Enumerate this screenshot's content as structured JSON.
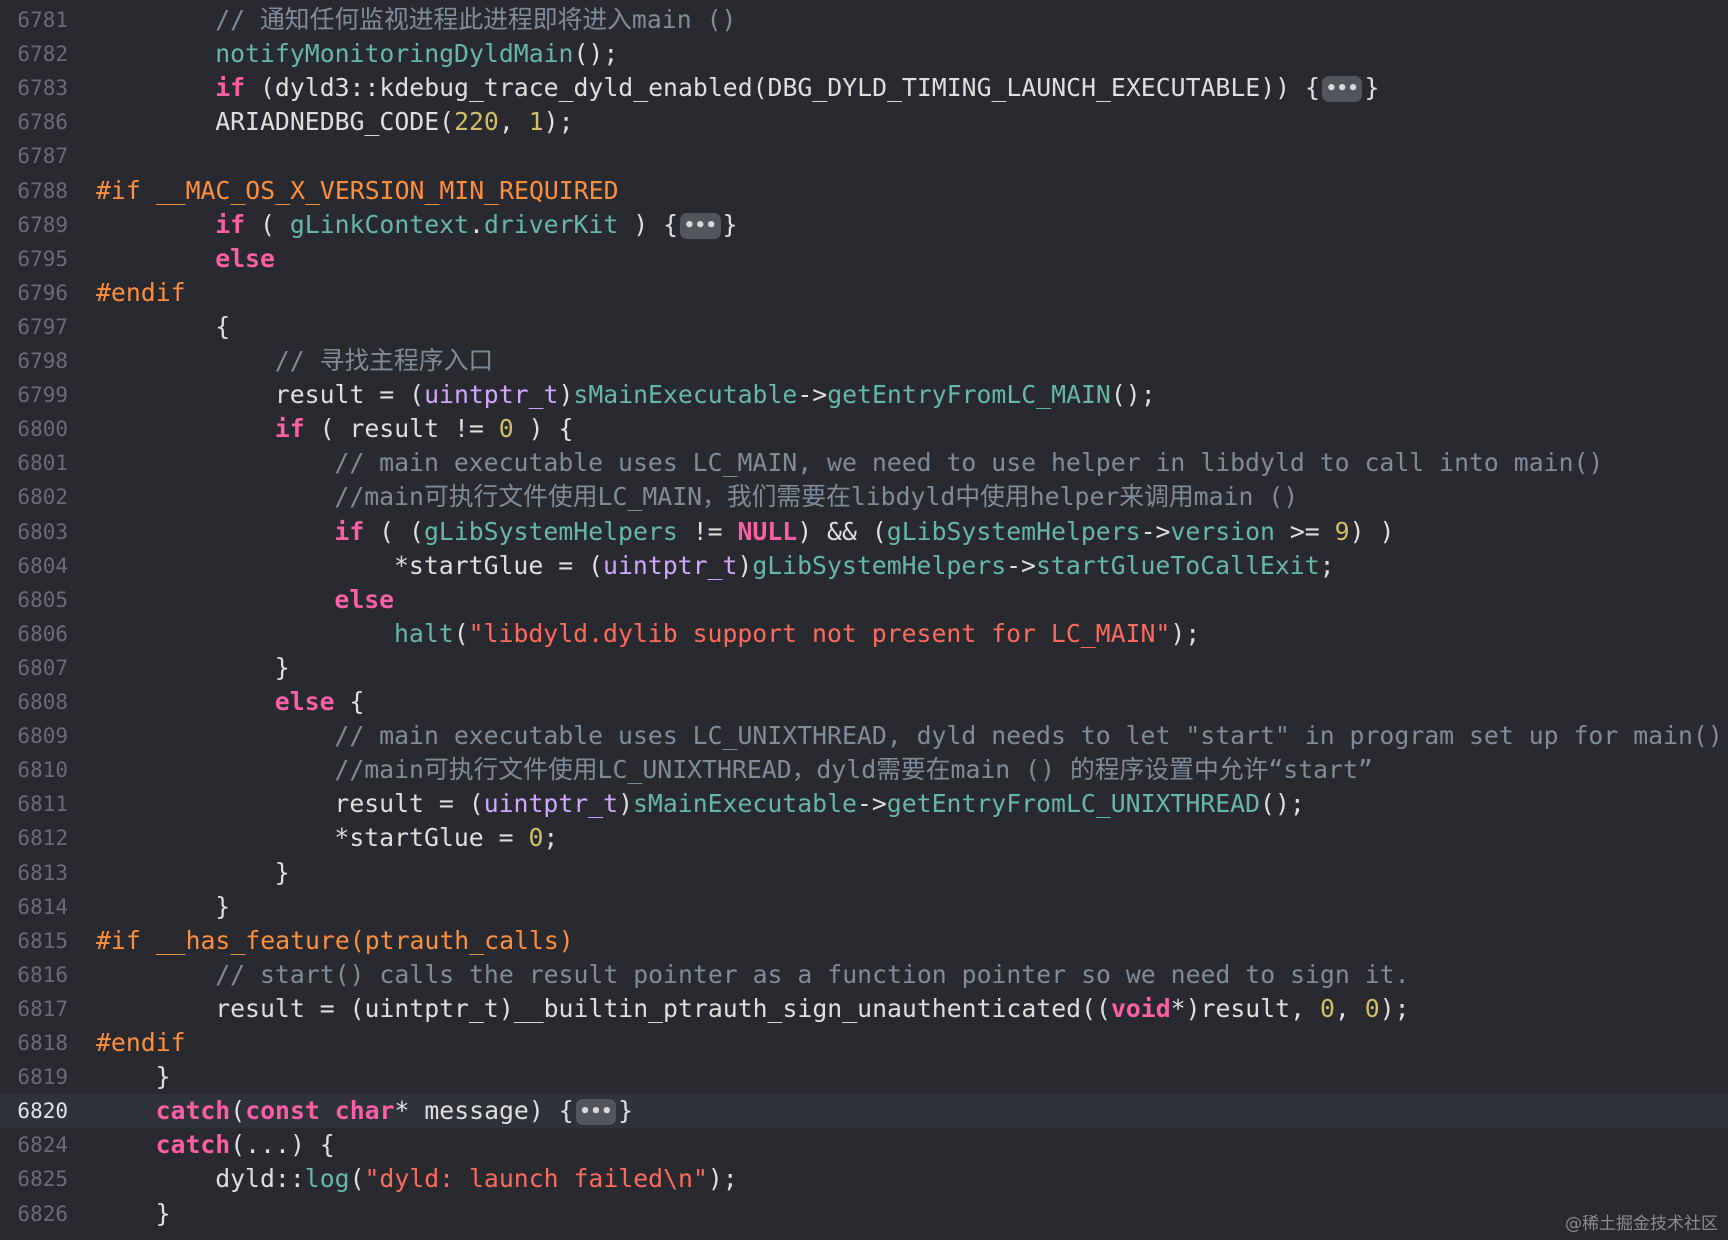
{
  "colors": {
    "background": "#292a30",
    "current_line": "#2f3239",
    "line_number": "#6c6c74",
    "keyword": "#fc5fa3",
    "preprocessor": "#fd8f3f",
    "comment": "#7f8c98",
    "function": "#67b7a4",
    "type": "#d0a8ff",
    "string": "#fc6a5d",
    "number": "#d0bf69",
    "plain": "#dfdfe0"
  },
  "watermark": "@稀土掘金技术社区",
  "lines": [
    {
      "n": "6781",
      "indent": 8,
      "tokens": [
        {
          "t": "cm",
          "v": "// 通知任何监视进程此进程即将进入main ()"
        }
      ]
    },
    {
      "n": "6782",
      "indent": 8,
      "tokens": [
        {
          "t": "fn",
          "v": "notifyMonitoringDyldMain"
        },
        {
          "t": "pl",
          "v": "();"
        }
      ]
    },
    {
      "n": "6783",
      "indent": 8,
      "tokens": [
        {
          "t": "kw",
          "v": "if"
        },
        {
          "t": "pl",
          "v": " (dyld3::kdebug_trace_dyld_enabled(DBG_DYLD_TIMING_LAUNCH_EXECUTABLE)) {"
        },
        {
          "t": "fold",
          "v": "•••"
        },
        {
          "t": "pl",
          "v": "}"
        }
      ]
    },
    {
      "n": "6786",
      "indent": 8,
      "tokens": [
        {
          "t": "pl",
          "v": "ARIADNEDBG_CODE("
        },
        {
          "t": "nm",
          "v": "220"
        },
        {
          "t": "pl",
          "v": ", "
        },
        {
          "t": "nm",
          "v": "1"
        },
        {
          "t": "pl",
          "v": ");"
        }
      ]
    },
    {
      "n": "6787",
      "indent": 0,
      "tokens": []
    },
    {
      "n": "6788",
      "indent": 0,
      "tokens": [
        {
          "t": "pre",
          "v": "#if __MAC_OS_X_VERSION_MIN_REQUIRED"
        }
      ]
    },
    {
      "n": "6789",
      "indent": 8,
      "tokens": [
        {
          "t": "kw",
          "v": "if"
        },
        {
          "t": "pl",
          "v": " ( "
        },
        {
          "t": "fn",
          "v": "gLinkContext"
        },
        {
          "t": "pl",
          "v": "."
        },
        {
          "t": "fn",
          "v": "driverKit"
        },
        {
          "t": "pl",
          "v": " ) {"
        },
        {
          "t": "fold",
          "v": "•••"
        },
        {
          "t": "pl",
          "v": "}"
        }
      ]
    },
    {
      "n": "6795",
      "indent": 8,
      "tokens": [
        {
          "t": "kw",
          "v": "else"
        }
      ]
    },
    {
      "n": "6796",
      "indent": 0,
      "tokens": [
        {
          "t": "pre",
          "v": "#endif"
        }
      ]
    },
    {
      "n": "6797",
      "indent": 8,
      "tokens": [
        {
          "t": "pl",
          "v": "{"
        }
      ]
    },
    {
      "n": "6798",
      "indent": 12,
      "tokens": [
        {
          "t": "cm",
          "v": "// 寻找主程序入口"
        }
      ]
    },
    {
      "n": "6799",
      "indent": 12,
      "tokens": [
        {
          "t": "pl",
          "v": "result = ("
        },
        {
          "t": "tp",
          "v": "uintptr_t"
        },
        {
          "t": "pl",
          "v": ")"
        },
        {
          "t": "fn",
          "v": "sMainExecutable"
        },
        {
          "t": "pl",
          "v": "->"
        },
        {
          "t": "fn",
          "v": "getEntryFromLC_MAIN"
        },
        {
          "t": "pl",
          "v": "();"
        }
      ]
    },
    {
      "n": "6800",
      "indent": 12,
      "tokens": [
        {
          "t": "kw",
          "v": "if"
        },
        {
          "t": "pl",
          "v": " ( result != "
        },
        {
          "t": "nm",
          "v": "0"
        },
        {
          "t": "pl",
          "v": " ) {"
        }
      ]
    },
    {
      "n": "6801",
      "indent": 16,
      "tokens": [
        {
          "t": "cm",
          "v": "// main executable uses LC_MAIN, we need to use helper in libdyld to call into main()"
        }
      ]
    },
    {
      "n": "6802",
      "indent": 16,
      "tokens": [
        {
          "t": "cm",
          "v": "//main可执行文件使用LC_MAIN，我们需要在libdyld中使用helper来调用main ()"
        }
      ]
    },
    {
      "n": "6803",
      "indent": 16,
      "tokens": [
        {
          "t": "kw",
          "v": "if"
        },
        {
          "t": "pl",
          "v": " ( ("
        },
        {
          "t": "fn",
          "v": "gLibSystemHelpers"
        },
        {
          "t": "pl",
          "v": " != "
        },
        {
          "t": "kw",
          "v": "NULL"
        },
        {
          "t": "pl",
          "v": ") && ("
        },
        {
          "t": "fn",
          "v": "gLibSystemHelpers"
        },
        {
          "t": "pl",
          "v": "->"
        },
        {
          "t": "fn",
          "v": "version"
        },
        {
          "t": "pl",
          "v": " >= "
        },
        {
          "t": "nm",
          "v": "9"
        },
        {
          "t": "pl",
          "v": ") )"
        }
      ]
    },
    {
      "n": "6804",
      "indent": 20,
      "tokens": [
        {
          "t": "pl",
          "v": "*startGlue = ("
        },
        {
          "t": "tp",
          "v": "uintptr_t"
        },
        {
          "t": "pl",
          "v": ")"
        },
        {
          "t": "fn",
          "v": "gLibSystemHelpers"
        },
        {
          "t": "pl",
          "v": "->"
        },
        {
          "t": "fn",
          "v": "startGlueToCallExit"
        },
        {
          "t": "pl",
          "v": ";"
        }
      ]
    },
    {
      "n": "6805",
      "indent": 16,
      "tokens": [
        {
          "t": "kw",
          "v": "else"
        }
      ]
    },
    {
      "n": "6806",
      "indent": 20,
      "tokens": [
        {
          "t": "fn",
          "v": "halt"
        },
        {
          "t": "pl",
          "v": "("
        },
        {
          "t": "st",
          "v": "\"libdyld.dylib support not present for LC_MAIN\""
        },
        {
          "t": "pl",
          "v": ");"
        }
      ]
    },
    {
      "n": "6807",
      "indent": 12,
      "tokens": [
        {
          "t": "pl",
          "v": "}"
        }
      ]
    },
    {
      "n": "6808",
      "indent": 12,
      "tokens": [
        {
          "t": "kw",
          "v": "else"
        },
        {
          "t": "pl",
          "v": " {"
        }
      ]
    },
    {
      "n": "6809",
      "indent": 16,
      "tokens": [
        {
          "t": "cm",
          "v": "// main executable uses LC_UNIXTHREAD, dyld needs to let \"start\" in program set up for main()"
        }
      ]
    },
    {
      "n": "6810",
      "indent": 16,
      "tokens": [
        {
          "t": "cm",
          "v": "//main可执行文件使用LC_UNIXTHREAD，dyld需要在main () 的程序设置中允许“start”"
        }
      ]
    },
    {
      "n": "6811",
      "indent": 16,
      "tokens": [
        {
          "t": "pl",
          "v": "result = ("
        },
        {
          "t": "tp",
          "v": "uintptr_t"
        },
        {
          "t": "pl",
          "v": ")"
        },
        {
          "t": "fn",
          "v": "sMainExecutable"
        },
        {
          "t": "pl",
          "v": "->"
        },
        {
          "t": "fn",
          "v": "getEntryFromLC_UNIXTHREAD"
        },
        {
          "t": "pl",
          "v": "();"
        }
      ]
    },
    {
      "n": "6812",
      "indent": 16,
      "tokens": [
        {
          "t": "pl",
          "v": "*startGlue = "
        },
        {
          "t": "nm",
          "v": "0"
        },
        {
          "t": "pl",
          "v": ";"
        }
      ]
    },
    {
      "n": "6813",
      "indent": 12,
      "tokens": [
        {
          "t": "pl",
          "v": "}"
        }
      ]
    },
    {
      "n": "6814",
      "indent": 8,
      "tokens": [
        {
          "t": "pl",
          "v": "}"
        }
      ]
    },
    {
      "n": "6815",
      "indent": 0,
      "tokens": [
        {
          "t": "pre",
          "v": "#if __has_feature(ptrauth_calls)"
        }
      ]
    },
    {
      "n": "6816",
      "indent": 8,
      "tokens": [
        {
          "t": "cm",
          "v": "// start() calls the result pointer as a function pointer so we need to sign it."
        }
      ]
    },
    {
      "n": "6817",
      "indent": 8,
      "tokens": [
        {
          "t": "pl",
          "v": "result = (uintptr_t)__builtin_ptrauth_sign_unauthenticated(("
        },
        {
          "t": "kw",
          "v": "void"
        },
        {
          "t": "pl",
          "v": "*)result, "
        },
        {
          "t": "nm",
          "v": "0"
        },
        {
          "t": "pl",
          "v": ", "
        },
        {
          "t": "nm",
          "v": "0"
        },
        {
          "t": "pl",
          "v": ");"
        }
      ]
    },
    {
      "n": "6818",
      "indent": 0,
      "tokens": [
        {
          "t": "pre",
          "v": "#endif"
        }
      ]
    },
    {
      "n": "6819",
      "indent": 4,
      "tokens": [
        {
          "t": "pl",
          "v": "}"
        }
      ]
    },
    {
      "n": "6820",
      "indent": 4,
      "current": true,
      "tokens": [
        {
          "t": "kw",
          "v": "catch"
        },
        {
          "t": "pl",
          "v": "("
        },
        {
          "t": "kw",
          "v": "const"
        },
        {
          "t": "pl",
          "v": " "
        },
        {
          "t": "kw",
          "v": "char"
        },
        {
          "t": "pl",
          "v": "* message) {"
        },
        {
          "t": "fold",
          "v": "•••"
        },
        {
          "t": "pl",
          "v": "}"
        }
      ]
    },
    {
      "n": "6824",
      "indent": 4,
      "tokens": [
        {
          "t": "kw",
          "v": "catch"
        },
        {
          "t": "pl",
          "v": "(...) {"
        }
      ]
    },
    {
      "n": "6825",
      "indent": 8,
      "tokens": [
        {
          "t": "pl",
          "v": "dyld::"
        },
        {
          "t": "fn",
          "v": "log"
        },
        {
          "t": "pl",
          "v": "("
        },
        {
          "t": "st",
          "v": "\"dyld: launch failed\\n\""
        },
        {
          "t": "pl",
          "v": ");"
        }
      ]
    },
    {
      "n": "6826",
      "indent": 4,
      "tokens": [
        {
          "t": "pl",
          "v": "}"
        }
      ]
    }
  ]
}
